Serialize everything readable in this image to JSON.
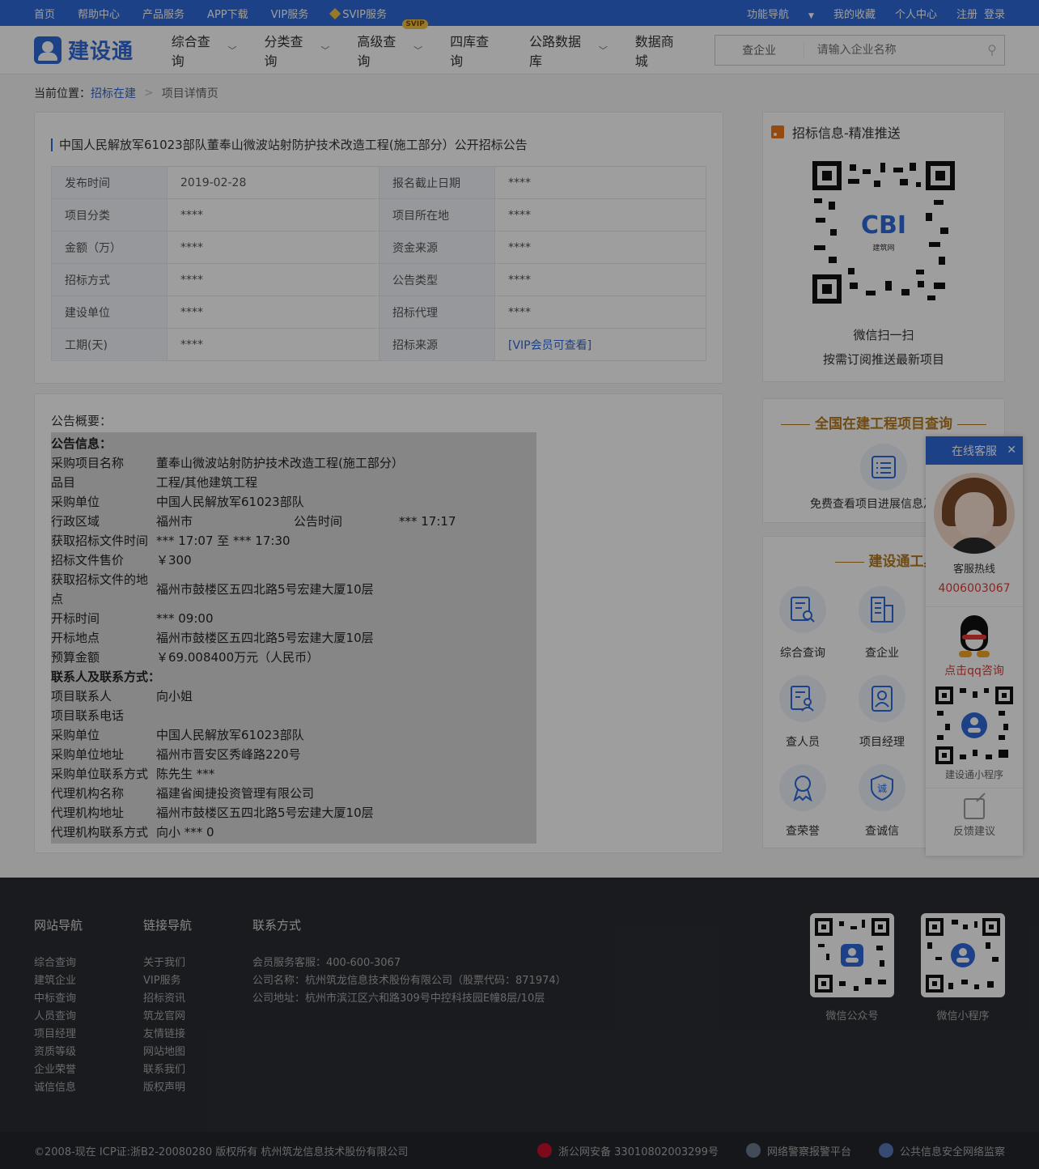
{
  "topbar": {
    "left": [
      "首页",
      "帮助中心",
      "产品服务",
      "APP下载",
      "VIP服务",
      "SVIP服务"
    ],
    "right": [
      "功能导航",
      "我的收藏",
      "个人中心",
      "注册",
      "登录"
    ]
  },
  "header": {
    "logo": "建设通",
    "nav": [
      "综合查询",
      "分类查询",
      "高级查询",
      "四库查询",
      "公路数据库",
      "数据商城"
    ],
    "svip_badge": "SVIP",
    "search_scope": "查企业",
    "search_placeholder": "请输入企业名称"
  },
  "breadcrumb": {
    "label": "当前位置：",
    "link": "招标在建",
    "sep": ">",
    "current": "项目详情页"
  },
  "project": {
    "title": "中国人民解放军61023部队董奉山微波站射防护技术改造工程(施工部分）公开招标公告",
    "rows": [
      [
        "发布时间",
        "2019-02-28",
        "报名截止日期",
        "****"
      ],
      [
        "项目分类",
        "****",
        "项目所在地",
        "****"
      ],
      [
        "金额（万）",
        "****",
        "资金来源",
        "****"
      ],
      [
        "招标方式",
        "****",
        "公告类型",
        "****"
      ],
      [
        "建设单位",
        "****",
        "招标代理",
        "****"
      ],
      [
        "工期(天)",
        "****",
        "招标来源",
        "[VIP会员可查看]"
      ]
    ]
  },
  "summary": {
    "title": "公告概要：",
    "section1": "公告信息：",
    "rows1": [
      [
        "采购项目名称",
        "董奉山微波站射防护技术改造工程(施工部分）"
      ],
      [
        "品目",
        "工程/其他建筑工程"
      ],
      [
        "采购单位",
        "中国人民解放军61023部队"
      ],
      [
        "行政区域",
        "福州市"
      ],
      [
        "获取招标文件时间",
        "*** 17:07  至  *** 17:30"
      ],
      [
        "招标文件售价",
        "￥300"
      ]
    ],
    "notice_time_label": "公告时间",
    "notice_time_value": "*** 17:17",
    "place_key_1": "获取招标文件的地",
    "place_key_2": "点",
    "place_value": "福州市鼓楼区五四北路5号宏建大厦10层",
    "rows2": [
      [
        "开标时间",
        "*** 09:00"
      ],
      [
        "开标地点",
        "福州市鼓楼区五四北路5号宏建大厦10层"
      ],
      [
        "预算金额",
        "￥69.008400万元（人民币）"
      ]
    ],
    "section2": "联系人及联系方式：",
    "rows3": [
      [
        "项目联系人",
        "向小姐"
      ],
      [
        "项目联系电话",
        ""
      ],
      [
        "采购单位",
        "中国人民解放军61023部队"
      ],
      [
        "采购单位地址",
        "福州市晋安区秀峰路220号"
      ],
      [
        "采购单位联系方式",
        "陈先生 ***"
      ],
      [
        "代理机构名称",
        "福建省闽捷投资管理有限公司"
      ],
      [
        "代理机构地址",
        "福州市鼓楼区五四北路5号宏建大厦10层"
      ],
      [
        "代理机构联系方式",
        "向小 *** 0"
      ]
    ]
  },
  "sidebar": {
    "rss_title": "招标信息-精准推送",
    "qr_text": "CBI",
    "qr_sub": "建筑网",
    "qr_cap1": "微信扫一扫",
    "qr_cap2": "按需订阅推送最新项目",
    "proj_title": "全国在建工程项目查询",
    "proj_desc": "免费查看项目进展信息及关系",
    "tools_title": "建设通工具",
    "tools": [
      "综合查询",
      "查企业",
      "查人员",
      "项目经理",
      "查荣誉",
      "查诚信"
    ]
  },
  "chat": {
    "head": "在线客服",
    "label": "客服热线",
    "phone": "4006003067",
    "qq": "点击qq咨询",
    "mini": "建设通小程序",
    "feedback": "反馈建议"
  },
  "footer": {
    "col1_title": "网站导航",
    "col1": [
      "综合查询",
      "建筑企业",
      "中标查询",
      "人员查询",
      "项目经理",
      "资质等级",
      "企业荣誉",
      "诚信信息"
    ],
    "col2_title": "链接导航",
    "col2": [
      "关于我们",
      "VIP服务",
      "招标资讯",
      "筑龙官网",
      "友情链接",
      "网站地图",
      "联系我们",
      "版权声明"
    ],
    "col3_title": "联系方式",
    "col3": [
      "会员服务客服：400-600-3067",
      "公司名称：杭州筑龙信息技术股份有限公司（股票代码：871974）",
      "公司地址：杭州市滨江区六和路309号中控科技园E幢8层/10层"
    ],
    "qr1": "微信公众号",
    "qr2": "微信小程序",
    "copyright": "©2008-现在 ICP证:浙B2-20080280   版权所有 杭州筑龙信息技术股份有限公司",
    "badge1": "浙公网安备 33010802003299号",
    "badge2": "网络警察报警平台",
    "badge3": "公共信息安全网络监察"
  },
  "colors": {
    "primary": "#2f69d8",
    "gold": "#b57a1f",
    "red": "#e53935"
  }
}
